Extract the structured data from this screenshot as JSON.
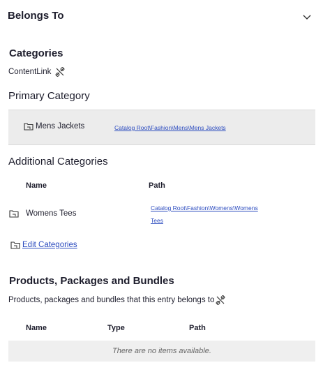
{
  "header": {
    "title": "Belongs To",
    "toggle_icon": "chevron-down-icon"
  },
  "categories": {
    "heading": "Categories",
    "content_link_label": "ContentLink",
    "content_link_icon": "unlink-icon"
  },
  "primary_category": {
    "heading": "Primary Category",
    "name": "Mens Jackets",
    "path": "Catalog Root\\Fashion\\Mens\\Mens Jackets"
  },
  "additional_categories": {
    "heading": "Additional Categories",
    "columns": {
      "name": "Name",
      "path": "Path"
    },
    "rows": [
      {
        "name": "Womens Tees",
        "path_line1": "Catalog Root\\Fashion\\Womens\\Womens",
        "path_line2": "Tees"
      }
    ],
    "edit_label": "Edit Categories"
  },
  "products": {
    "heading": "Products, Packages and Bundles",
    "description": "Products, packages and bundles that this entry belongs to",
    "columns": {
      "name": "Name",
      "type": "Type",
      "path": "Path"
    },
    "empty_message": "There are no items available."
  },
  "colors": {
    "link": "#2b4bbf",
    "text": "#1e1e2d",
    "panel": "#ececec"
  }
}
